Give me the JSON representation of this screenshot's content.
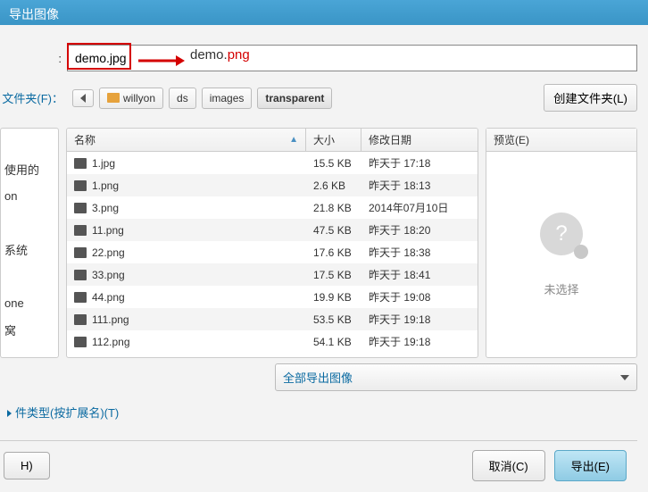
{
  "title": "导出图像",
  "filename_label": ":",
  "filename_value": "demo.jpg",
  "annotation": {
    "base": "demo.",
    "ext": "png"
  },
  "folder_label": "文件夹(F)：",
  "path": [
    "willyon",
    "ds",
    "images",
    "transparent"
  ],
  "create_folder": "创建文件夹(L)",
  "left_items": [
    "",
    "使用的",
    "on",
    "",
    "系统",
    "",
    "one",
    "窝",
    ""
  ],
  "columns": {
    "name": "名称",
    "size": "大小",
    "date": "修改日期"
  },
  "files": [
    {
      "name": "1.jpg",
      "size": "15.5 KB",
      "date": "昨天于 17:18"
    },
    {
      "name": "1.png",
      "size": "2.6 KB",
      "date": "昨天于 18:13"
    },
    {
      "name": "3.png",
      "size": "21.8 KB",
      "date": "2014年07月10日"
    },
    {
      "name": "11.png",
      "size": "47.5 KB",
      "date": "昨天于 18:20"
    },
    {
      "name": "22.png",
      "size": "17.6 KB",
      "date": "昨天于 18:38"
    },
    {
      "name": "33.png",
      "size": "17.5 KB",
      "date": "昨天于 18:41"
    },
    {
      "name": "44.png",
      "size": "19.9 KB",
      "date": "昨天于 19:08"
    },
    {
      "name": "111.png",
      "size": "53.5 KB",
      "date": "昨天于 19:18"
    },
    {
      "name": "112.png",
      "size": "54.1 KB",
      "date": "昨天于 19:18"
    }
  ],
  "preview_label": "预览(E)",
  "preview_empty": "未选择",
  "export_type": "全部导出图像",
  "file_type_link": "件类型(按扩展名)(T)",
  "help_btn": "H)",
  "cancel_btn": "取消(C)",
  "export_btn": "导出(E)"
}
